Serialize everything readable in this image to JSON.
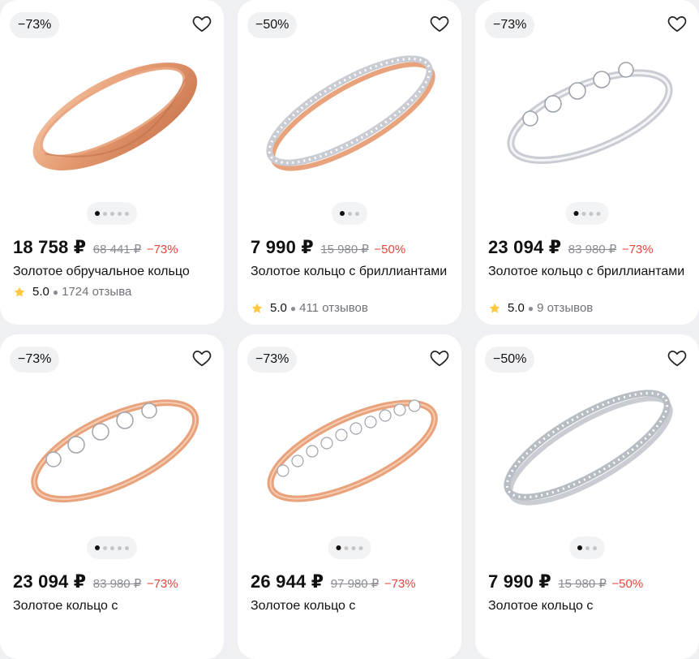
{
  "products": [
    {
      "discount_badge": "−73%",
      "price": "18 758 ₽",
      "old_price": "68 441 ₽",
      "discount": "−73%",
      "title": "Золотое обручальное кольцо",
      "rating": "5.0",
      "reviews": "1724 отзыва"
    },
    {
      "discount_badge": "−50%",
      "price": "7 990 ₽",
      "old_price": "15 980 ₽",
      "discount": "−50%",
      "title": "Золотое кольцо с бриллиантами",
      "rating": "5.0",
      "reviews": "411 отзывов"
    },
    {
      "discount_badge": "−73%",
      "price": "23 094 ₽",
      "old_price": "83 980 ₽",
      "discount": "−73%",
      "title": "Золотое кольцо с бриллиантами",
      "rating": "5.0",
      "reviews": "9 отзывов"
    },
    {
      "discount_badge": "−73%",
      "price": "23 094 ₽",
      "old_price": "83 980 ₽",
      "discount": "−73%",
      "title": "Золотое кольцо с"
    },
    {
      "discount_badge": "−73%",
      "price": "26 944 ₽",
      "old_price": "97 980 ₽",
      "discount": "−73%",
      "title": "Золотое кольцо с"
    },
    {
      "discount_badge": "−50%",
      "price": "7 990 ₽",
      "old_price": "15 980 ₽",
      "discount": "−50%",
      "title": "Золотое кольцо с"
    }
  ],
  "colors": {
    "discount": "#e8453c",
    "star": "#ffc83d",
    "rose_gold": "#e8a27c",
    "white_gold": "#c9ccd2"
  }
}
